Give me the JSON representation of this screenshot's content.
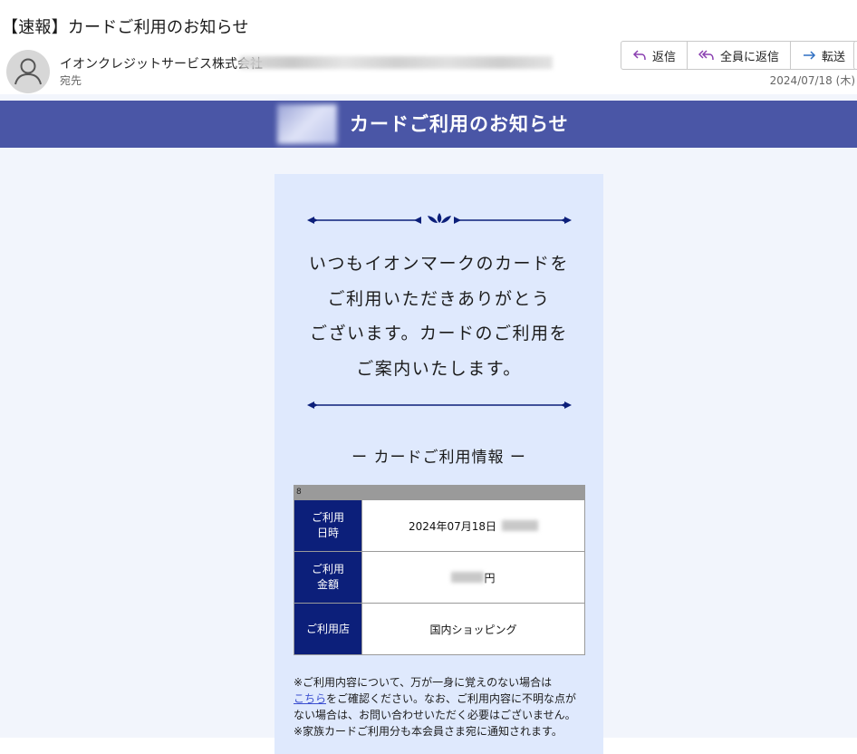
{
  "email": {
    "subject": "【速報】カードご利用のお知らせ",
    "sender_name": "イオンクレジットサービス株式会社",
    "to_label": "宛先",
    "date": "2024/07/18 (木)",
    "actions": [
      {
        "label": "返信",
        "icon": "reply-icon"
      },
      {
        "label": "全員に返信",
        "icon": "reply-all-icon"
      },
      {
        "label": "転送",
        "icon": "forward-icon"
      }
    ]
  },
  "body": {
    "banner_title": "カードご利用のお知らせ",
    "intro_lines": [
      "いつもイオンマークのカードを",
      "ご利用いただきありがとう",
      "ございます。カードのご利用を",
      "ご案内いたします。"
    ],
    "section_title": "ー カードご利用情報 ー",
    "table_head": "8",
    "rows": [
      {
        "label_line1": "ご利用",
        "label_line2": "日時",
        "value": "2024年07月18日"
      },
      {
        "label_line1": "ご利用",
        "label_line2": "金額",
        "value_suffix": "円"
      },
      {
        "label_line1": "ご利用店",
        "label_line2": "",
        "value": "国内ショッピング"
      }
    ],
    "notes": {
      "line1": "※ご利用内容について、万が一身に覚えのない場合は",
      "link": "こちら",
      "line2_rest": "をご確認ください。なお、ご利用内容に不明な点が",
      "line3": "ない場合は、お問い合わせいただく必要はございません。",
      "line4": "※家族カードご利用分も本会員さま宛に通知されます。"
    }
  },
  "colors": {
    "banner": "#4a56a6",
    "card_bg": "#dfe9fd",
    "label_bg": "#0c1f7a",
    "link": "#3b4fd0"
  }
}
